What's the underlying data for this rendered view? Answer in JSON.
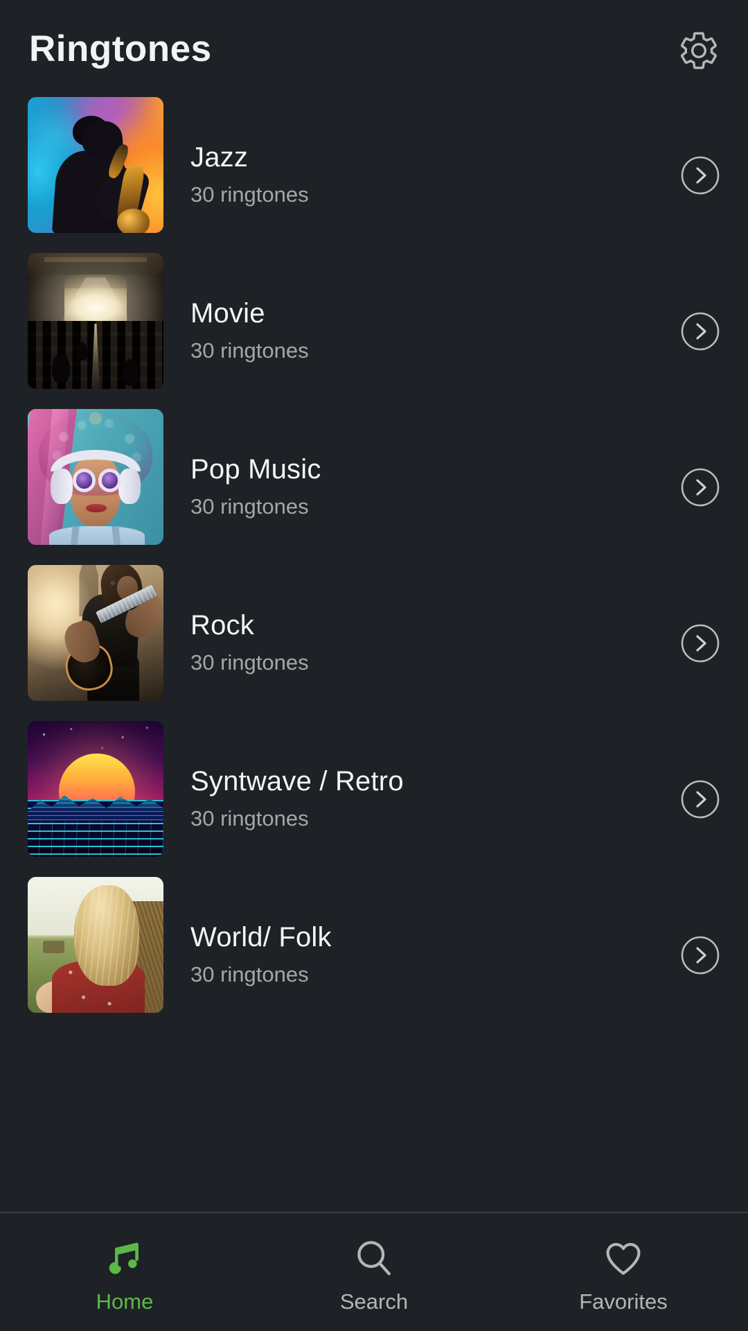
{
  "header": {
    "title": "Ringtones",
    "settings_icon": "gear-icon"
  },
  "categories": [
    {
      "title": "Jazz",
      "count": "30 ringtones",
      "art": "jazz",
      "chevron_icon": "chevron-right-circle-icon"
    },
    {
      "title": "Movie",
      "count": "30 ringtones",
      "art": "movie",
      "chevron_icon": "chevron-right-circle-icon"
    },
    {
      "title": "Pop Music",
      "count": "30 ringtones",
      "art": "pop",
      "chevron_icon": "chevron-right-circle-icon"
    },
    {
      "title": "Rock",
      "count": "30 ringtones",
      "art": "rock",
      "chevron_icon": "chevron-right-circle-icon"
    },
    {
      "title": "Syntwave / Retro",
      "count": "30 ringtones",
      "art": "syn",
      "chevron_icon": "chevron-right-circle-icon"
    },
    {
      "title": "World/ Folk",
      "count": "30 ringtones",
      "art": "folk",
      "chevron_icon": "chevron-right-circle-icon"
    }
  ],
  "bottom_nav": {
    "items": [
      {
        "label": "Home",
        "icon": "music-note-icon",
        "active": true
      },
      {
        "label": "Search",
        "icon": "search-icon",
        "active": false
      },
      {
        "label": "Favorites",
        "icon": "heart-icon",
        "active": false
      }
    ]
  },
  "colors": {
    "background": "#1e2126",
    "title_text": "#f3f4f5",
    "subtitle_text": "#a4a7aa",
    "accent_active": "#5cb946",
    "nav_inactive": "#b3b6b9",
    "divider": "#3a3e44"
  }
}
